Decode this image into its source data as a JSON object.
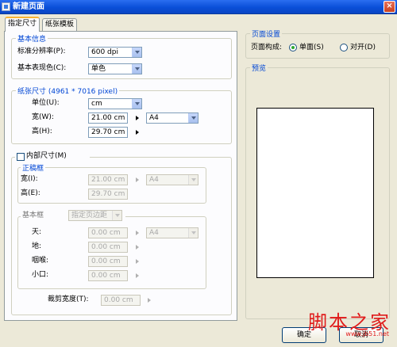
{
  "window": {
    "title": "新建页面",
    "close_glyph": "×"
  },
  "tabs": [
    {
      "label": "指定尺寸"
    },
    {
      "label": "纸张模板"
    }
  ],
  "basic_info": {
    "legend": "基本信息",
    "resolution_label": "标准分辨率(P):",
    "resolution_value": "600 dpi",
    "color_label": "基本表现色(C):",
    "color_value": "单色"
  },
  "paper_size": {
    "legend": "纸张尺寸 (4961 * 7016 pixel)",
    "unit_label": "单位(U):",
    "unit_value": "cm",
    "width_label": "宽(W):",
    "width_value": "21.00 cm",
    "height_label": "高(H):",
    "height_value": "29.70 cm",
    "preset_value": "A4"
  },
  "inner_size": {
    "checkbox_label": "内部尺寸(M)",
    "frame_legend": "正稿框",
    "width_label": "宽(I):",
    "width_value": "21.00 cm",
    "height_label": "高(E):",
    "height_value": "29.70 cm",
    "preset_value": "A4",
    "basic_frame_label": "基本框",
    "margin_select": "指定页边距",
    "top_label": "天:",
    "top_value": "0.00 cm",
    "bottom_label": "地:",
    "bottom_value": "0.00 cm",
    "gutter_label": "咽喉:",
    "gutter_value": "0.00 cm",
    "fore_label": "小口:",
    "fore_value": "0.00 cm",
    "margin_preset": "A4",
    "bleed_label": "裁剪宽度(T):",
    "bleed_value": "0.00 cm"
  },
  "page_settings": {
    "legend": "页面设置",
    "layout_label": "页面构成:",
    "single_label": "单面(S)",
    "spread_label": "对开(D)",
    "selected": "单面(S)"
  },
  "preview": {
    "legend": "预览"
  },
  "buttons": {
    "ok": "确定",
    "cancel": "取消"
  },
  "watermark": {
    "text": "脚本之家",
    "url": "www.jb51.net"
  }
}
